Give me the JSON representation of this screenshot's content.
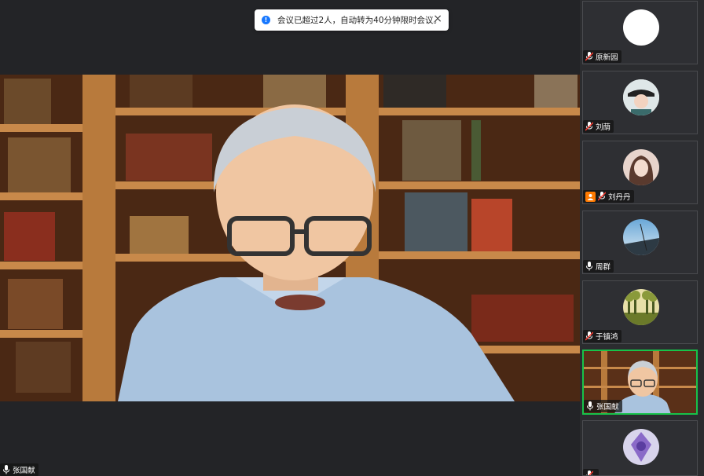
{
  "toast": {
    "message": "会议已超过2人，自动转为40分钟限时会议。",
    "info_icon": "info-icon",
    "close_icon": "×"
  },
  "main_video": {
    "speaker_name": "张国献"
  },
  "participants": [
    {
      "name": "原新园",
      "avatar": "white-circle-avatar",
      "mic": "muted"
    },
    {
      "name": "刘荫",
      "avatar": "person-photo-avatar",
      "mic": "muted"
    },
    {
      "name": "刘丹丹",
      "avatar": "woman-photo-avatar",
      "mic": "muted",
      "host": true
    },
    {
      "name": "周群",
      "avatar": "landscape-avatar",
      "mic": "on"
    },
    {
      "name": "于镇鸿",
      "avatar": "trees-avatar",
      "mic": "muted"
    },
    {
      "name": "张国献",
      "avatar": "video",
      "mic": "on",
      "active": true
    },
    {
      "name": "",
      "avatar": "purple-avatar",
      "mic": "muted"
    }
  ],
  "colors": {
    "active_border": "#17c24a",
    "host_badge": "#ff7a00",
    "toast_info": "#1677ff"
  }
}
